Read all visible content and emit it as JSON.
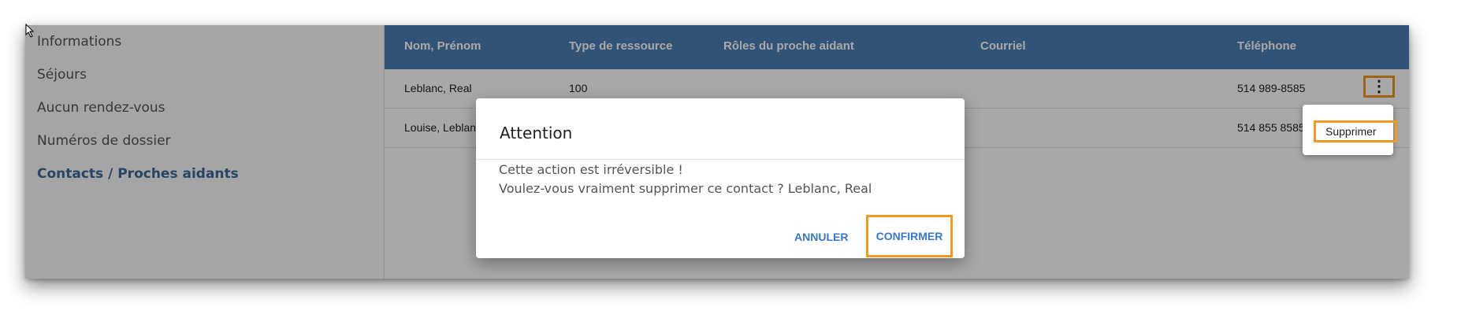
{
  "sidebar": {
    "items": [
      {
        "label": "Informations"
      },
      {
        "label": "Séjours"
      },
      {
        "label": "Aucun rendez-vous"
      },
      {
        "label": "Numéros de dossier"
      },
      {
        "label": "Contacts / Proches aidants",
        "active": true
      }
    ]
  },
  "table": {
    "columns": [
      "Nom, Prénom",
      "Type de ressource",
      "Rôles du proche aidant",
      "Courriel",
      "Téléphone"
    ],
    "rows": [
      {
        "name": "Leblanc, Real",
        "type": "100",
        "roles": "",
        "email": "",
        "phone": "514 989-8585"
      },
      {
        "name": "Louise, Leblanc",
        "type": "",
        "roles": "",
        "email": "",
        "phone": "514 855 8585"
      }
    ]
  },
  "row_menu": {
    "items": [
      "Supprimer"
    ]
  },
  "dialog": {
    "title": "Attention",
    "line1": "Cette action est irréversible !",
    "line2": "Voulez-vous vraiment supprimer ce contact ? Leblanc, Real",
    "cancel_label": "ANNULER",
    "confirm_label": "CONFIRMER"
  },
  "colors": {
    "header_bg": "#4a7fb5",
    "accent": "#3a78c2",
    "highlight": "#f29a1f",
    "active_nav": "#3c6a9c"
  },
  "icons": {
    "row_menu": "more-vert-icon",
    "cursor": "mouse-pointer-icon"
  }
}
